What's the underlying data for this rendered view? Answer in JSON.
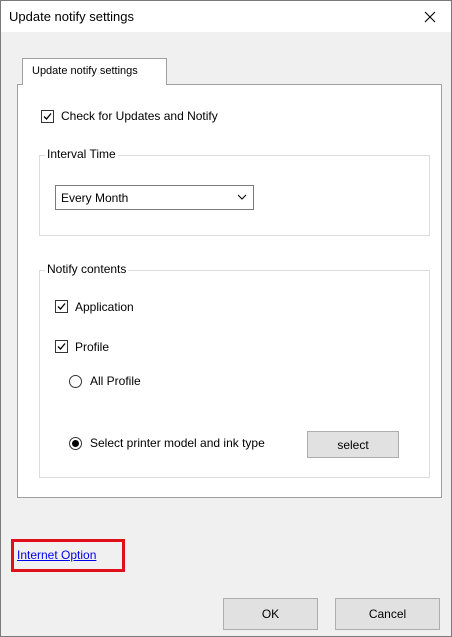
{
  "window": {
    "title": "Update notify settings",
    "close_icon": "close-icon"
  },
  "tab": {
    "label": "Update notify settings"
  },
  "check_updates": {
    "label": "Check for Updates and Notify",
    "checked": true
  },
  "interval": {
    "group_label": "Interval Time",
    "selected": "Every Month"
  },
  "notify": {
    "group_label": "Notify contents",
    "application": {
      "label": "Application",
      "checked": true
    },
    "profile": {
      "label": "Profile",
      "checked": true
    },
    "all_profile": {
      "label": "All Profile",
      "selected": false
    },
    "select_printer": {
      "label": "Select printer model and ink type",
      "selected": true
    },
    "select_button": "select"
  },
  "internet_option": "Internet Option",
  "footer": {
    "ok": "OK",
    "cancel": "Cancel"
  },
  "colors": {
    "highlight": "#e0101a",
    "link": "#0000ee"
  }
}
